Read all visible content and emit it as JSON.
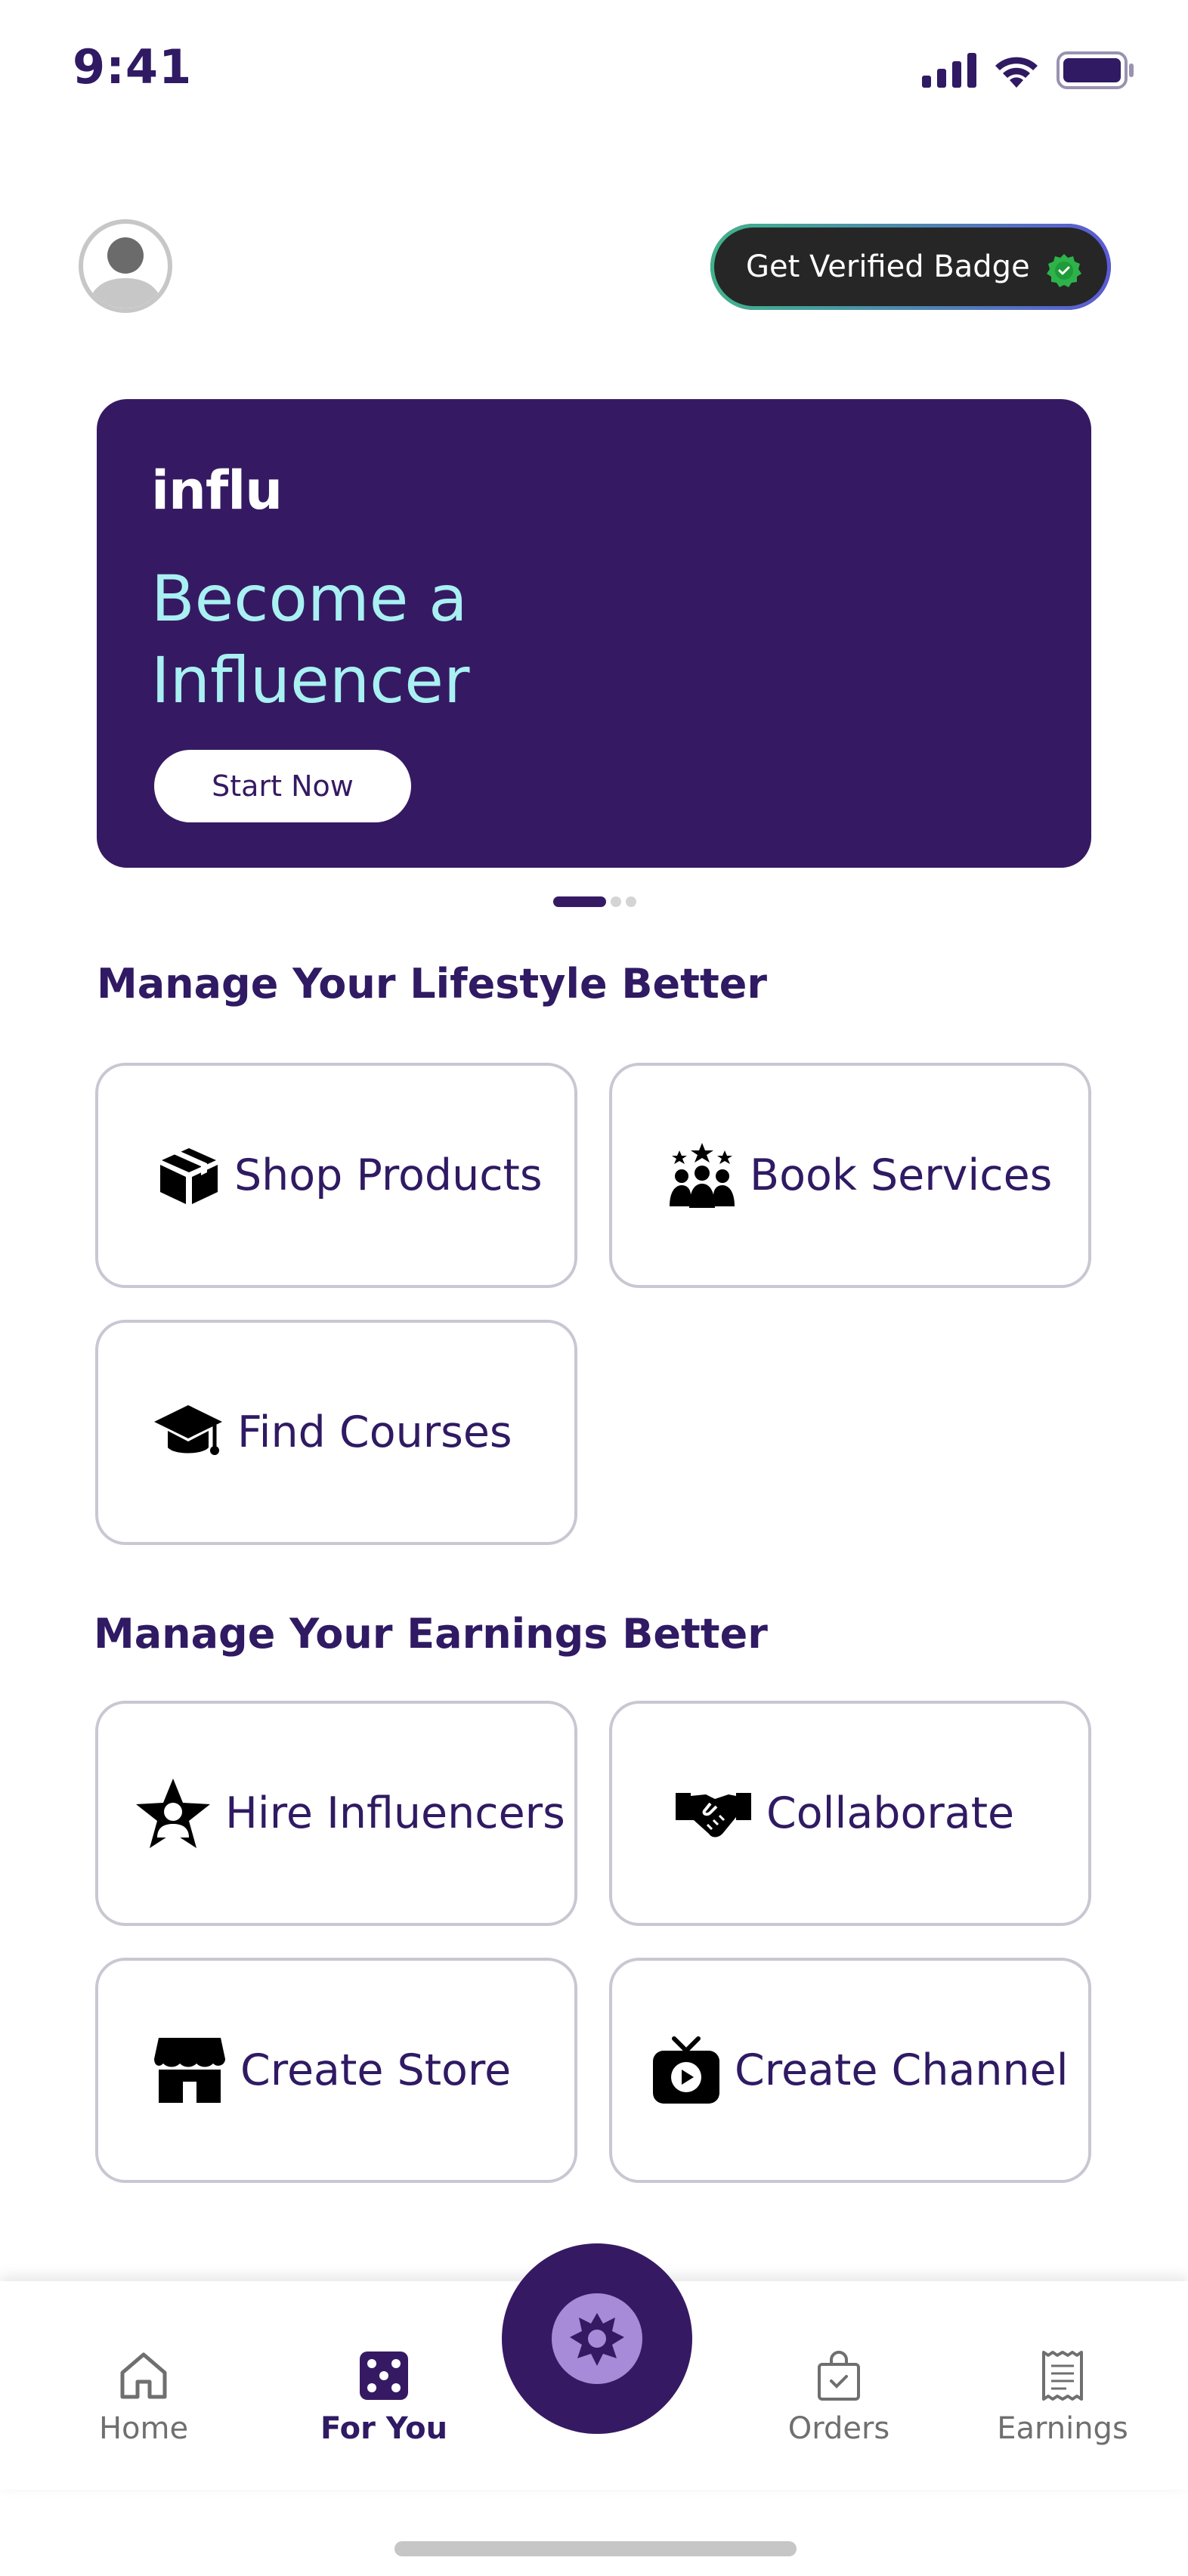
{
  "status_bar": {
    "time": "9:41"
  },
  "header": {
    "verified_badge_label": "Get Verified Badge"
  },
  "banner": {
    "logo": "influ",
    "title": "Become a Influencer",
    "cta_label": "Start Now",
    "page_count": 3,
    "active_page": 1
  },
  "lifestyle": {
    "title": "Manage Your Lifestyle Better",
    "items": [
      {
        "label": "Shop Products",
        "icon": "package-icon"
      },
      {
        "label": "Book Services",
        "icon": "group-icon"
      },
      {
        "label": "Find Courses",
        "icon": "graduation-cap-icon"
      }
    ]
  },
  "earnings": {
    "title": "Manage Your Earnings Better",
    "items": [
      {
        "label": "Hire Influencers",
        "icon": "star-person-icon"
      },
      {
        "label": "Collaborate",
        "icon": "handshake-icon"
      },
      {
        "label": "Create Store",
        "icon": "store-icon"
      },
      {
        "label": "Create Channel",
        "icon": "tv-play-icon"
      }
    ]
  },
  "tabbar": {
    "items": [
      {
        "label": "Home",
        "icon": "home-icon",
        "active": false
      },
      {
        "label": "For You",
        "icon": "dice-icon",
        "active": true
      },
      {
        "label": "Orders",
        "icon": "shopping-bag-icon",
        "active": false
      },
      {
        "label": "Earnings",
        "icon": "receipt-icon",
        "active": false
      }
    ],
    "center_icon": "brand-logo-icon"
  },
  "colors": {
    "primary": "#351a63",
    "accent_text": "#a9f0f2",
    "verified_green": "#2db34a",
    "card_border": "#c9c7d2"
  }
}
